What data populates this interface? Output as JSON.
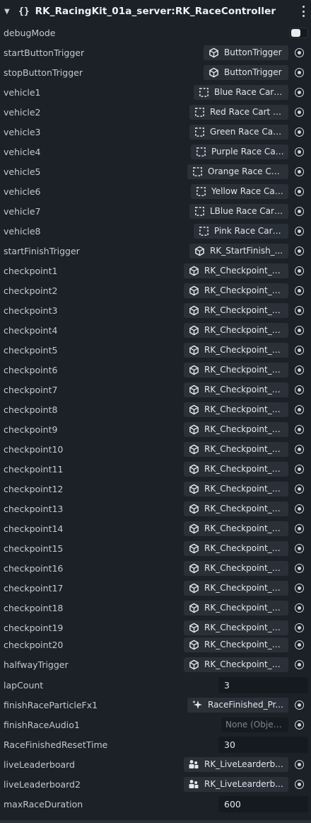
{
  "header": {
    "braces": "{}",
    "title": "RK_RacingKit_01a_server:RK_RaceController"
  },
  "rows": [
    {
      "label": "debugMode",
      "kind": "toggle"
    },
    {
      "label": "startButtonTrigger",
      "kind": "ref",
      "icon": "cube-icon",
      "value": "ButtonTrigger"
    },
    {
      "label": "stopButtonTrigger",
      "kind": "ref",
      "icon": "cube-icon",
      "value": "ButtonTrigger"
    },
    {
      "label": "vehicle1",
      "kind": "ref",
      "icon": "entity-dashed-icon",
      "value": "Blue Race Cart ..."
    },
    {
      "label": "vehicle2",
      "kind": "ref",
      "icon": "entity-dashed-icon",
      "value": "Red Race Cart 0..."
    },
    {
      "label": "vehicle3",
      "kind": "ref",
      "icon": "entity-dashed-icon",
      "value": "Green Race Cart..."
    },
    {
      "label": "vehicle4",
      "kind": "ref",
      "icon": "entity-dashed-icon",
      "value": "Purple Race Car..."
    },
    {
      "label": "vehicle5",
      "kind": "ref",
      "icon": "entity-dashed-icon",
      "value": "Orange Race Car..."
    },
    {
      "label": "vehicle6",
      "kind": "ref",
      "icon": "entity-dashed-icon",
      "value": "Yellow Race Car..."
    },
    {
      "label": "vehicle7",
      "kind": "ref",
      "icon": "entity-dashed-icon",
      "value": "LBlue Race Cart..."
    },
    {
      "label": "vehicle8",
      "kind": "ref",
      "icon": "entity-dashed-icon",
      "value": "Pink Race Cart ..."
    },
    {
      "label": "startFinishTrigger",
      "kind": "ref",
      "icon": "cube-icon",
      "value": "RK_StartFinish_..."
    },
    {
      "label": "checkpoint1",
      "kind": "ref",
      "icon": "cube-icon",
      "value": "RK_Checkpoint_T..."
    },
    {
      "label": "checkpoint2",
      "kind": "ref",
      "icon": "cube-icon",
      "value": "RK_Checkpoint_T..."
    },
    {
      "label": "checkpoint3",
      "kind": "ref",
      "icon": "cube-icon",
      "value": "RK_Checkpoint_T..."
    },
    {
      "label": "checkpoint4",
      "kind": "ref",
      "icon": "cube-icon",
      "value": "RK_Checkpoint_T..."
    },
    {
      "label": "checkpoint5",
      "kind": "ref",
      "icon": "cube-icon",
      "value": "RK_Checkpoint_T..."
    },
    {
      "label": "checkpoint6",
      "kind": "ref",
      "icon": "cube-icon",
      "value": "RK_Checkpoint_T..."
    },
    {
      "label": "checkpoint7",
      "kind": "ref",
      "icon": "cube-icon",
      "value": "RK_Checkpoint_T..."
    },
    {
      "label": "checkpoint8",
      "kind": "ref",
      "icon": "cube-icon",
      "value": "RK_Checkpoint_T..."
    },
    {
      "label": "checkpoint9",
      "kind": "ref",
      "icon": "cube-icon",
      "value": "RK_Checkpoint_T..."
    },
    {
      "label": "checkpoint10",
      "kind": "ref",
      "icon": "cube-icon",
      "value": "RK_Checkpoint_T..."
    },
    {
      "label": "checkpoint11",
      "kind": "ref",
      "icon": "cube-icon",
      "value": "RK_Checkpoint_T..."
    },
    {
      "label": "checkpoint12",
      "kind": "ref",
      "icon": "cube-icon",
      "value": "RK_Checkpoint_T..."
    },
    {
      "label": "checkpoint13",
      "kind": "ref",
      "icon": "cube-icon",
      "value": "RK_Checkpoint_T..."
    },
    {
      "label": "checkpoint14",
      "kind": "ref",
      "icon": "cube-icon",
      "value": "RK_Checkpoint_T..."
    },
    {
      "label": "checkpoint15",
      "kind": "ref",
      "icon": "cube-icon",
      "value": "RK_Checkpoint_T..."
    },
    {
      "label": "checkpoint16",
      "kind": "ref",
      "icon": "cube-icon",
      "value": "RK_Checkpoint_T..."
    },
    {
      "label": "checkpoint17",
      "kind": "ref",
      "icon": "cube-icon",
      "value": "RK_Checkpoint_T..."
    },
    {
      "label": "checkpoint18",
      "kind": "ref",
      "icon": "cube-icon",
      "value": "RK_Checkpoint_T..."
    },
    {
      "label": "checkpoint19",
      "kind": "ref",
      "icon": "cube-icon",
      "value": "RK_Checkpoint_T..."
    },
    {
      "label": "checkpoint20",
      "kind": "ref",
      "icon": "cube-icon",
      "value": "RK_Checkpoint_T..."
    },
    {
      "label": "halfwayTrigger",
      "kind": "ref",
      "icon": "cube-icon",
      "value": "RK_Checkpoint_T..."
    },
    {
      "label": "lapCount",
      "kind": "number",
      "value": "3"
    },
    {
      "label": "finishRaceParticleFx1",
      "kind": "ref",
      "icon": "sparkle-icon",
      "value": "RaceFinished_Pr..."
    },
    {
      "label": "finishRaceAudio1",
      "kind": "ref-none",
      "value": "None (Object)"
    },
    {
      "label": "RaceFinishedResetTime",
      "kind": "number",
      "value": "30"
    },
    {
      "label": "liveLeaderboard",
      "kind": "ref",
      "icon": "people-icon",
      "value": "RK_LiveLearderb..."
    },
    {
      "label": "liveLeaderboard2",
      "kind": "ref",
      "icon": "people-icon",
      "value": "RK_LiveLearderb..."
    },
    {
      "label": "maxRaceDuration",
      "kind": "number",
      "value": "600"
    }
  ]
}
